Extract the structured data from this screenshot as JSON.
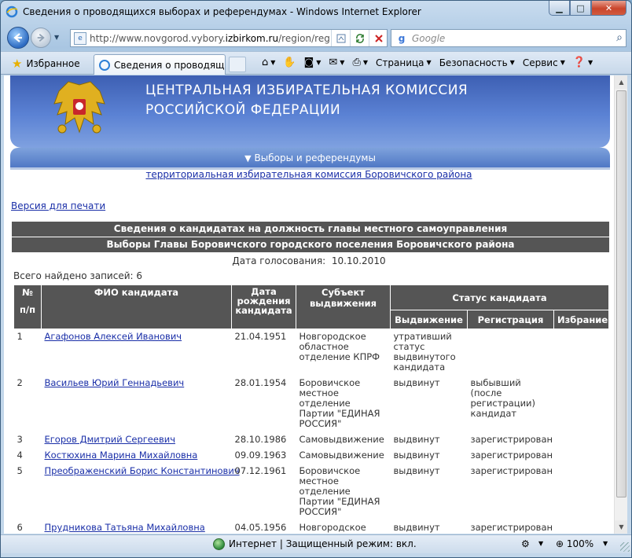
{
  "window": {
    "title": "Сведения о проводящихся выборах и референдумах - Windows Internet Explorer",
    "min_glyph": "▁",
    "max_glyph": "□",
    "close_glyph": "✕"
  },
  "address": {
    "url_prefix": "http://www.novgorod.vybory.",
    "url_domain": "izbirkom.ru",
    "url_suffix": "/region/reg",
    "search_placeholder": "Google"
  },
  "tabs": {
    "favorites_label": "Избранное",
    "active_tab_title": "Сведения о проводящ..."
  },
  "commandbar": {
    "page_label": "Страница",
    "safety_label": "Безопасность",
    "tools_label": "Сервис"
  },
  "banner": {
    "line1": "ЦЕНТРАЛЬНАЯ ИЗБИРАТЕЛЬНАЯ КОМИССИЯ",
    "line2": "РОССИЙСКОЙ ФЕДЕРАЦИИ"
  },
  "subnav": {
    "label": "Выборы и референдумы"
  },
  "page": {
    "tik_link": "территориальная избирательная комиссия Боровичского района",
    "print_link": "Версия для печати",
    "header1": "Сведения о кандидатах на должность главы местного самоуправления",
    "header2": "Выборы Главы Боровичского городского поселения Боровичского района",
    "vote_date_label": "Дата голосования:",
    "vote_date_value": "10.10.2010",
    "total_label": "Всего найдено записей:",
    "total_value": "6"
  },
  "table": {
    "col_num_top": "№",
    "col_num_bottom": "п/п",
    "col_name": "ФИО кандидата",
    "col_birth": "Дата рождения кандидата",
    "col_subject": "Субъект выдвижения",
    "col_status": "Статус кандидата",
    "col_nomination": "Выдвижение",
    "col_registration": "Регистрация",
    "col_election": "Избрание",
    "rows": [
      {
        "num": "1",
        "name": "Агафонов Алексей Иванович",
        "birth": "21.04.1951",
        "subject": "Новгородское областное отделение КПРФ",
        "nomination": "утративший статус выдвинутого кандидата",
        "registration": "",
        "election": ""
      },
      {
        "num": "2",
        "name": "Васильев Юрий Геннадьевич",
        "birth": "28.01.1954",
        "subject": "Боровичское местное отделение Партии \"ЕДИНАЯ РОССИЯ\"",
        "nomination": "выдвинут",
        "registration": "выбывший (после регистрации) кандидат",
        "election": ""
      },
      {
        "num": "3",
        "name": "Егоров Дмитрий Сергеевич",
        "birth": "28.10.1986",
        "subject": "Самовыдвижение",
        "nomination": "выдвинут",
        "registration": "зарегистрирован",
        "election": ""
      },
      {
        "num": "4",
        "name": "Костюхина Марина Михайловна",
        "birth": "09.09.1963",
        "subject": "Самовыдвижение",
        "nomination": "выдвинут",
        "registration": "зарегистрирован",
        "election": ""
      },
      {
        "num": "5",
        "name": "Преображенский Борис Константинович",
        "birth": "07.12.1961",
        "subject": "Боровичское местное отделение Партии \"ЕДИНАЯ РОССИЯ\"",
        "nomination": "выдвинут",
        "registration": "зарегистрирован",
        "election": ""
      },
      {
        "num": "6",
        "name": "Прудникова Татьяна Михайловна",
        "birth": "04.05.1956",
        "subject": "Новгородское региональное отделение ЛДПР",
        "nomination": "выдвинут",
        "registration": "зарегистрирован",
        "election": ""
      }
    ]
  },
  "statusbar": {
    "zone": "Интернет | Защищенный режим: вкл.",
    "zoom": "100%"
  },
  "colors": {
    "banner": "#4a6fc4",
    "header_bar": "#555555",
    "link": "#1a2fa8"
  }
}
